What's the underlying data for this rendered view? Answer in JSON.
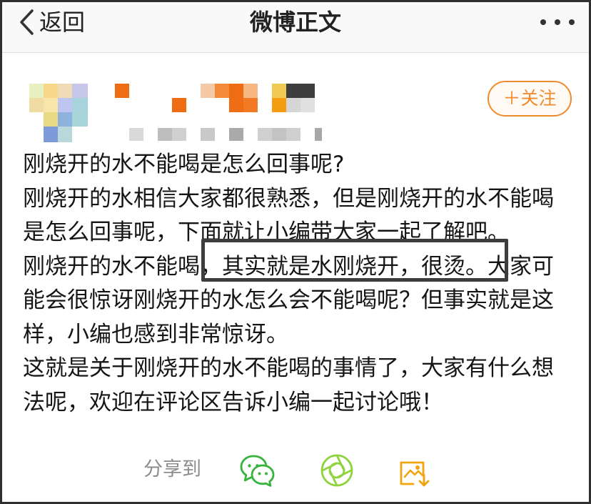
{
  "nav": {
    "back_label": "返回",
    "title": "微博正文",
    "back_icon": "chevron-left-icon",
    "more_icon": "more-dots-icon"
  },
  "profile": {
    "follow_label": "＋关注",
    "avatar_icon": "blurred-avatar",
    "name_icon": "blurred-username",
    "accent_color": "#ef8b2f"
  },
  "article": {
    "paragraphs": [
      "刚烧开的水不能喝是怎么回事呢?",
      "刚烧开的水相信大家都很熟悉，但是刚烧开的水不能喝是怎么回事呢，下面就让小编带大家一起了解吧。",
      "刚烧开的水不能喝，其实就是水刚烧开，很烫。大家可能会很惊讶刚烧开的水怎么会不能喝呢？但事实就是这样，小编也感到非常惊讶。",
      "这就是关于刚烧开的水不能喝的事情了，大家有什么想法呢，欢迎在评论区告诉小编一起讨论哦！"
    ]
  },
  "share": {
    "label": "分享到",
    "wechat_icon": "wechat-icon",
    "moments_icon": "moments-icon",
    "save_icon": "save-image-icon",
    "wechat_color": "#36b43b",
    "moments_color": "#8fd43e",
    "save_color": "#f2a40f"
  }
}
